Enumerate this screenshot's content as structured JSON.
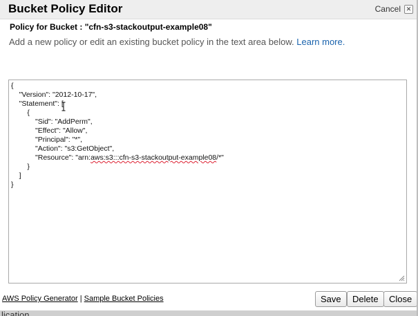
{
  "dialog": {
    "title": "Bucket Policy Editor",
    "cancel_label": "Cancel",
    "policy_for": "Policy for Bucket : \"cfn-s3-stackoutput-example08\"",
    "description": "Add a new policy or edit an existing bucket policy in the text area below.",
    "learn_more": "Learn more."
  },
  "editor": {
    "lines": [
      "{",
      "    \"Version\": \"2012-10-17\",",
      "    \"Statement\": [",
      "        {",
      "            \"Sid\": \"AddPerm\",",
      "            \"Effect\": \"Allow\",",
      "            \"Principal\": \"*\",",
      "            \"Action\": \"s3:GetObject\",",
      "            \"Resource\": \"arn:aws:s3:::cfn-s3-stackoutput-example08/*\"",
      "        }",
      "    ]",
      "}"
    ]
  },
  "footer": {
    "policy_generator": "AWS Policy Generator",
    "separator": "|",
    "sample_policies": "Sample Bucket Policies",
    "save": "Save",
    "delete": "Delete",
    "close": "Close"
  },
  "background": {
    "partial_text": "lication"
  }
}
